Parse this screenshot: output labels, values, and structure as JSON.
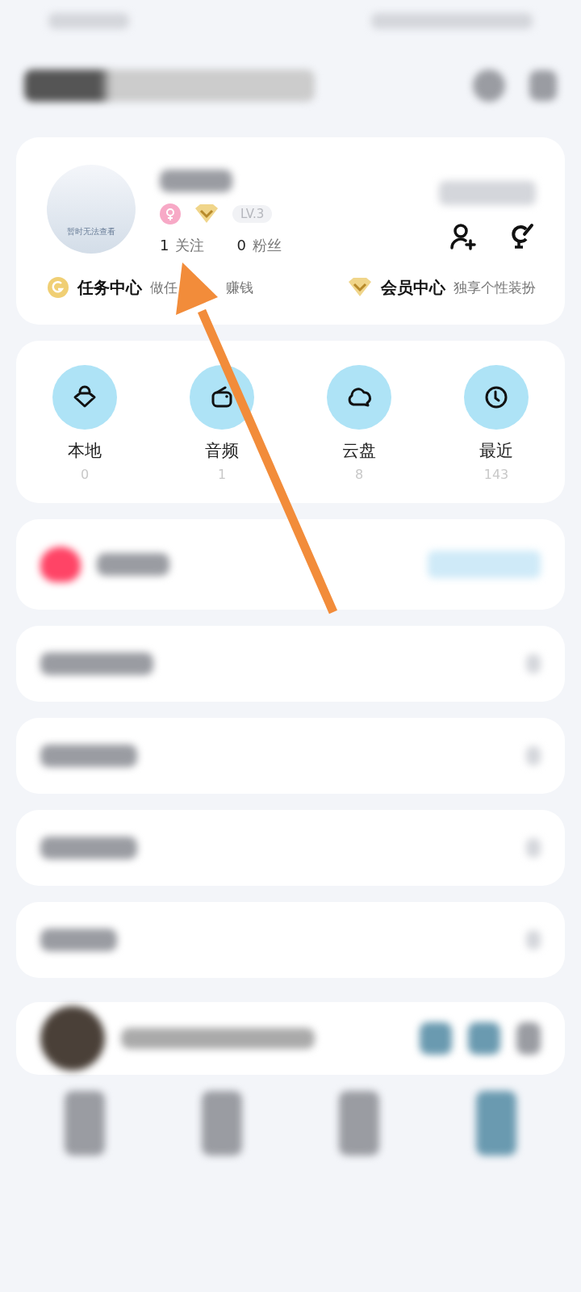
{
  "profile": {
    "avatar_caption": "暂时无法查看",
    "level": "LV.3",
    "stats": [
      {
        "count": "1",
        "label": "关注"
      },
      {
        "count": "0",
        "label": "粉丝"
      }
    ],
    "links": [
      {
        "kind": "task",
        "title": "任务中心",
        "subtitle": "做任",
        "subtitle_after_arrow": "赚钱"
      },
      {
        "kind": "vip",
        "title": "会员中心",
        "subtitle": "独享个性装扮"
      }
    ]
  },
  "quick_access": [
    {
      "kind": "local",
      "label": "本地",
      "count": "0"
    },
    {
      "kind": "audio",
      "label": "音频",
      "count": "1"
    },
    {
      "kind": "cloud",
      "label": "云盘",
      "count": "8"
    },
    {
      "kind": "recent",
      "label": "最近",
      "count": "143"
    }
  ],
  "nav_tabs": [
    {
      "selected": false
    },
    {
      "selected": false
    },
    {
      "selected": false
    },
    {
      "selected": true
    }
  ]
}
